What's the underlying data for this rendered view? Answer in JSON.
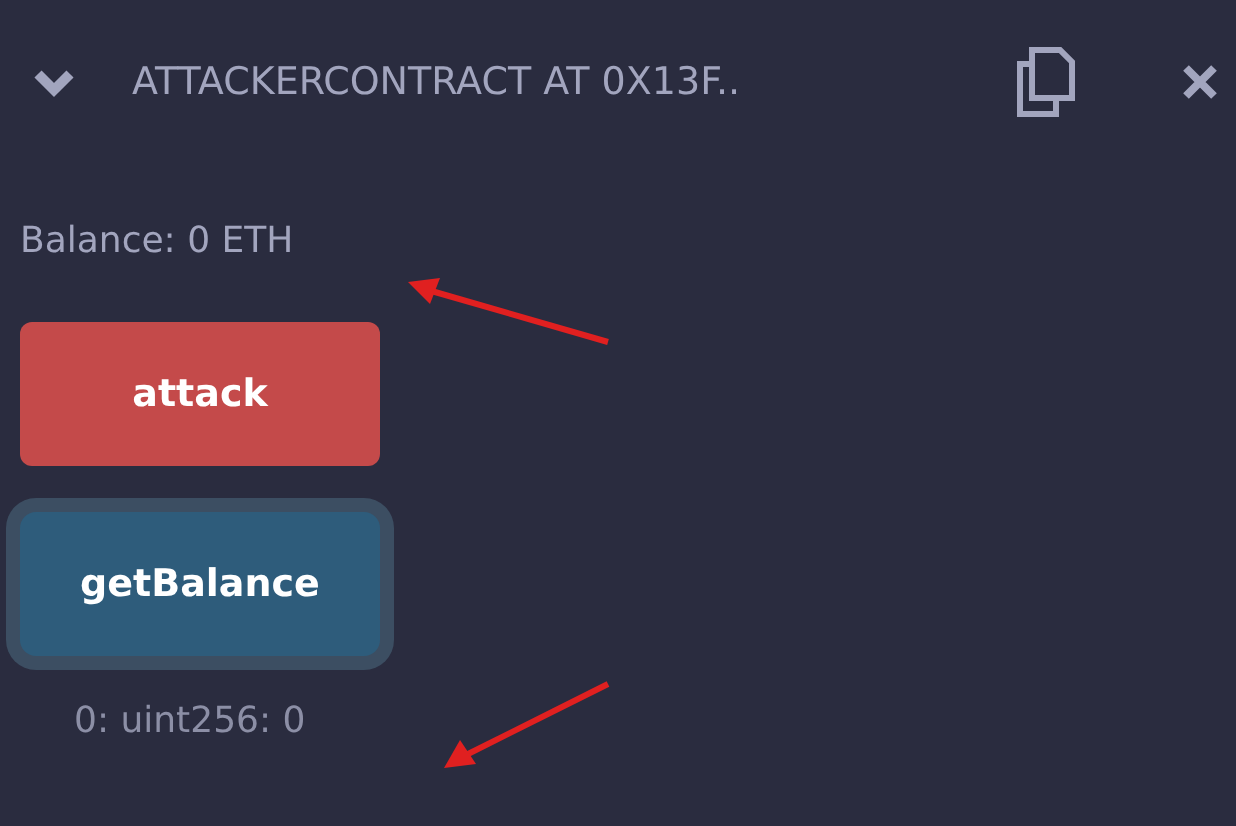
{
  "header": {
    "expanded": true,
    "title": "ATTACKERCONTRACT AT 0X13F.."
  },
  "balance": "Balance: 0 ETH",
  "buttons": [
    {
      "label": "attack",
      "kind": "transact",
      "focused": false
    },
    {
      "label": "getBalance",
      "kind": "call",
      "focused": true
    }
  ],
  "output": "0: uint256: 0"
}
